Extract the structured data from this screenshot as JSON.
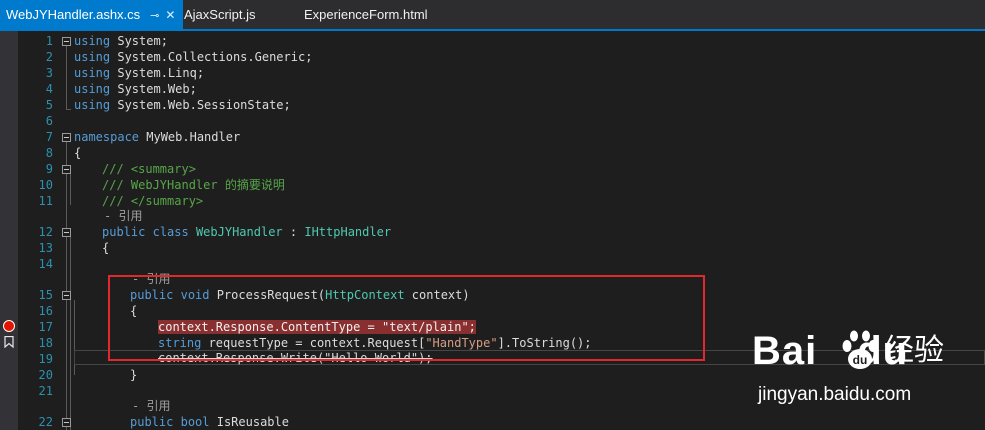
{
  "tabs": [
    {
      "label": "WebJYHandler.ashx.cs",
      "active": true,
      "pin_icon": "pin-icon",
      "close_icon": "close-icon"
    },
    {
      "label": "AjaxScript.js",
      "active": false
    },
    {
      "label": "ExperienceForm.html",
      "active": false
    }
  ],
  "line_numbers": [
    "1",
    "2",
    "3",
    "4",
    "5",
    "6",
    "7",
    "8",
    "9",
    "10",
    "11",
    "12",
    "13",
    "14",
    "15",
    "16",
    "17",
    "18",
    "19",
    "20",
    "21",
    "22"
  ],
  "code": {
    "l1_kw": "using",
    "l1_rest": " System;",
    "l2_kw": "using",
    "l2_rest": " System.Collections.Generic;",
    "l3_kw": "using",
    "l3_rest": " System.Linq;",
    "l4_kw": "using",
    "l4_rest": " System.Web;",
    "l5_kw": "using",
    "l5_rest": " System.Web.SessionState;",
    "l7_kw": "namespace",
    "l7_rest": " MyWeb.Handler",
    "l8": "{",
    "l9": "/// <summary>",
    "l10": "/// WebJYHandler 的摘要说明",
    "l11": "/// </summary>",
    "ref1": "- 引用",
    "l12_kw1": "public",
    "l12_kw2": "class",
    "l12_type": "WebJYHandler",
    "l12_colon": " : ",
    "l12_iface": "IHttpHandler",
    "l13": "{",
    "ref2": "- 引用",
    "l15_kw1": "public",
    "l15_kw2": "void",
    "l15_name": " ProcessRequest(",
    "l15_type": "HttpContext",
    "l15_end": " context)",
    "l16": "{",
    "l17_a": "context.Response.ContentType = ",
    "l17_str": "\"text/plain\"",
    "l17_end": ";",
    "l18_kw": "string",
    "l18_a": " requestType = context.Request[",
    "l18_str": "\"HandType\"",
    "l18_end": "].ToString();",
    "l19": "context.Response.Write(\"Hello World\");",
    "l20": "}",
    "ref3": "- 引用",
    "l22_kw1": "public",
    "l22_kw2": "bool",
    "l22_rest": " IsReusable"
  },
  "watermark": {
    "logo": "Bai",
    "logo_suffix": "du",
    "cn": "经验",
    "url": "jingyan.baidu.com"
  },
  "colors": {
    "accent": "#007acc",
    "keyword": "#569cd6",
    "type": "#4ec9b0",
    "comment": "#57a64a",
    "string": "#d69d85",
    "breakpoint": "#e51400",
    "highlight_box": "#e0282e"
  }
}
